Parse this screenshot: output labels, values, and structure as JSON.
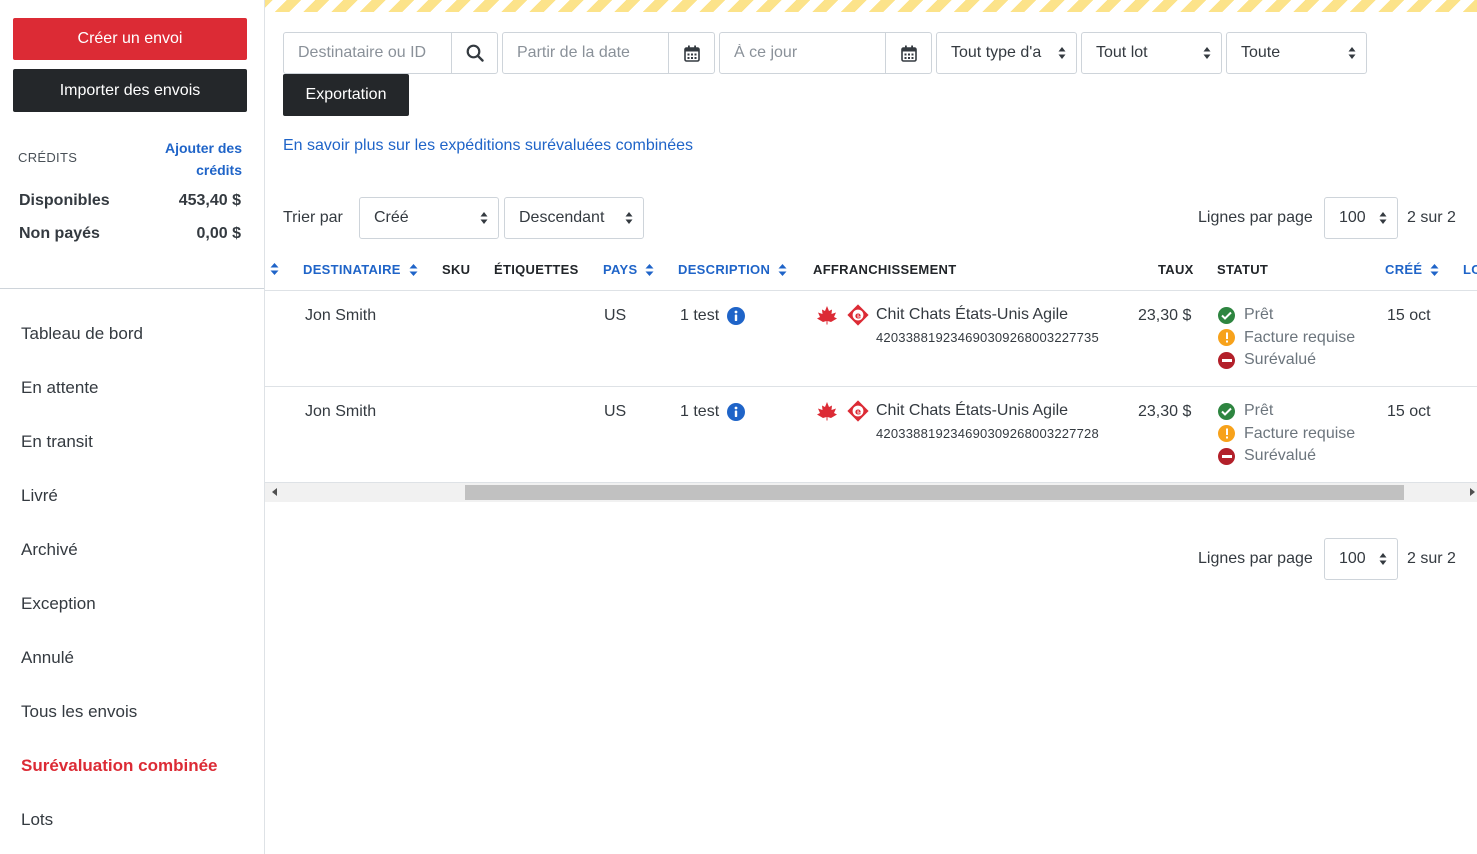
{
  "sidebar": {
    "create_label": "Créer un envoi",
    "import_label": "Importer des envois",
    "credits_label": "CRÉDITS",
    "add_credits_label": "Ajouter des crédits",
    "available_label": "Disponibles",
    "available_value": "453,40 $",
    "unpaid_label": "Non payés",
    "unpaid_value": "0,00 $",
    "nav": [
      {
        "label": "Tableau de bord"
      },
      {
        "label": "En attente"
      },
      {
        "label": "En transit"
      },
      {
        "label": "Livré"
      },
      {
        "label": "Archivé"
      },
      {
        "label": "Exception"
      },
      {
        "label": "Annulé"
      },
      {
        "label": "Tous les envois"
      },
      {
        "label": "Surévaluation combinée",
        "active": true
      },
      {
        "label": "Lots"
      }
    ]
  },
  "filters": {
    "search_placeholder": "Destinataire ou ID",
    "from_date_placeholder": "Partir de la date",
    "to_date_placeholder": "À ce jour",
    "type_value": "Tout type d'a",
    "batch_value": "Tout lot",
    "all_value": "Toute",
    "export_label": "Exportation"
  },
  "info_link": "En savoir plus sur les expéditions surévaluées combinées",
  "sorting": {
    "sort_by_label": "Trier par",
    "sort_field": "Créé",
    "sort_order": "Descendant",
    "rows_per_page_label": "Lignes par page",
    "rows_per_page": "100",
    "pages": "2 sur 2"
  },
  "table": {
    "headers": {
      "recipient": "DESTINATAIRE",
      "sku": "SKU",
      "labels": "ÉTIQUETTES",
      "country": "PAYS",
      "description": "DESCRIPTION",
      "postage": "AFFRANCHISSEMENT",
      "rate": "TAUX",
      "status": "STATUT",
      "created": "CRÉÉ",
      "location_partial": "LO"
    },
    "rows": [
      {
        "recipient": "Jon Smith",
        "country": "US",
        "description": "1 test",
        "service": "Chit Chats États-Unis Agile",
        "tracking": "420338819234690309268003227735",
        "rate": "23,30 $",
        "status": [
          "Prêt",
          "Facture requise",
          "Surévalué"
        ],
        "created": "15 oct"
      },
      {
        "recipient": "Jon Smith",
        "country": "US",
        "description": "1 test",
        "service": "Chit Chats États-Unis Agile",
        "tracking": "420338819234690309268003227728",
        "rate": "23,30 $",
        "status": [
          "Prêt",
          "Facture requise",
          "Surévalué"
        ],
        "created": "15 oct"
      }
    ]
  },
  "colors": {
    "brand_red": "#dc2b35",
    "dark": "#24272a",
    "link_blue": "#1f64c8",
    "status_ok": "#2e8540",
    "status_warn": "#f7a21b",
    "status_error": "#b3202a"
  }
}
